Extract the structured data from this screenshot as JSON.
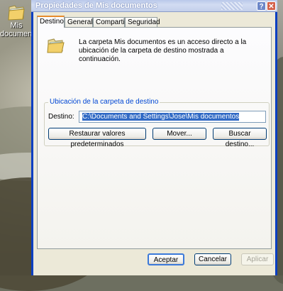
{
  "desktop": {
    "icon_label_line1": "Mis",
    "icon_label_line2": "documentos"
  },
  "window": {
    "title": "Propiedades de Mis documentos",
    "help_glyph": "?",
    "close_glyph": "✕"
  },
  "tabs": [
    {
      "label": "Destino",
      "active": true
    },
    {
      "label": "General",
      "active": false
    },
    {
      "label": "Compartir",
      "active": false
    },
    {
      "label": "Seguridad",
      "active": false
    }
  ],
  "info_text": "La carpeta Mis documentos es un acceso directo a la ubicación de la carpeta de destino mostrada a continuación.",
  "group": {
    "title": "Ubicación de la carpeta de destino",
    "destino_label": "Destino:",
    "destino_value": "C:\\Documents and Settings\\Jose\\Mis documentos"
  },
  "buttons": {
    "restore": "Restaurar valores predeterminados",
    "move": "Mover...",
    "find": "Buscar destino...",
    "ok": "Aceptar",
    "cancel": "Cancelar",
    "apply": "Aplicar"
  },
  "colors": {
    "accent_blue": "#0046d5",
    "window_frame": "#0a3fc2",
    "dialog_bg": "#ece9d8",
    "selection": "#316ac5"
  }
}
